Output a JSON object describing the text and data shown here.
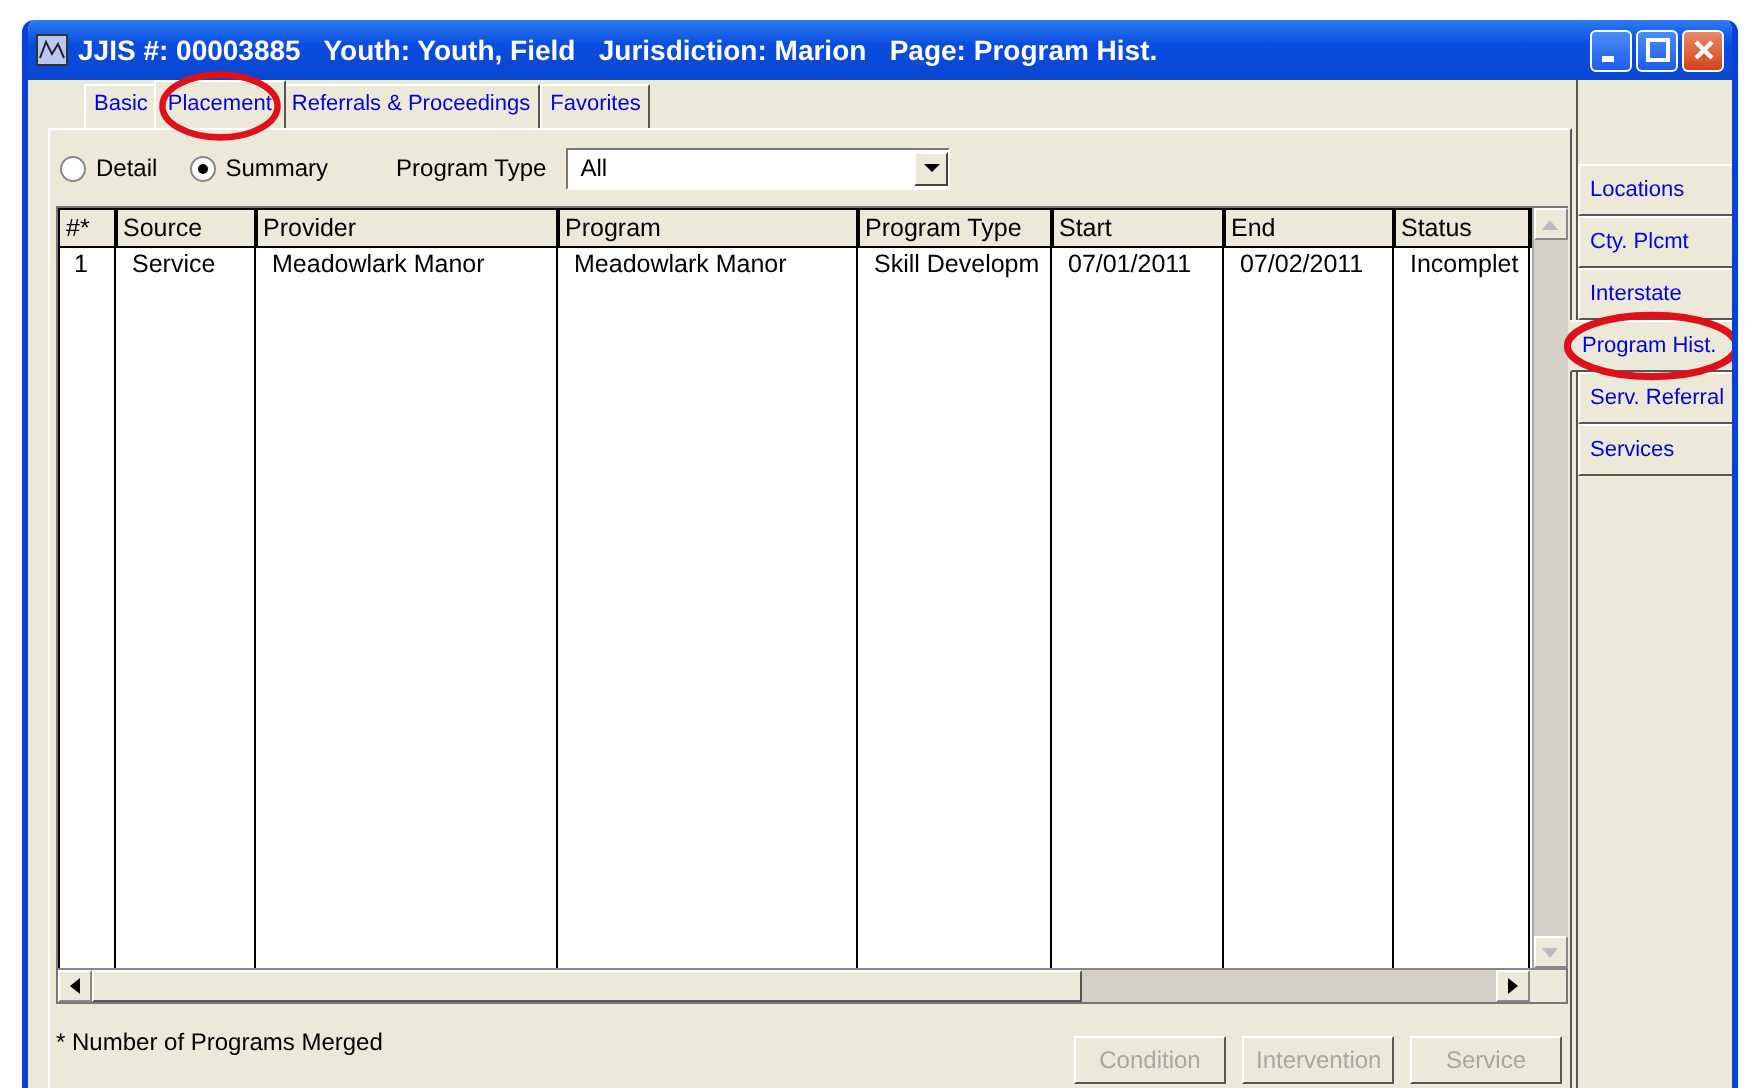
{
  "window": {
    "title": "JJIS #: 00003885   Youth: Youth, Field   Jurisdiction: Marion   Page: Program Hist."
  },
  "tabs": [
    {
      "label": "Basic",
      "selected": false,
      "circled": false
    },
    {
      "label": "Placement",
      "selected": true,
      "circled": true
    },
    {
      "label": "Referrals & Proceedings",
      "selected": false,
      "circled": false
    },
    {
      "label": "Favorites",
      "selected": false,
      "circled": false
    }
  ],
  "view": [
    {
      "label": "Detail",
      "selected": false
    },
    {
      "label": "Summary",
      "selected": true
    }
  ],
  "program_type": {
    "label": "Program Type",
    "value": "All"
  },
  "table": {
    "columns": [
      "#*",
      "Source",
      "Provider",
      "Program",
      "Program Type",
      "Start",
      "End",
      "Status"
    ],
    "rows": [
      [
        "1",
        "Service",
        "Meadowlark Manor",
        "Meadowlark Manor",
        "Skill Developm",
        "07/01/2011",
        "07/02/2011",
        "Incomplet"
      ]
    ]
  },
  "footnote": "* Number of Programs Merged",
  "buttons": [
    {
      "label": "Condition",
      "disabled": true
    },
    {
      "label": "Intervention",
      "disabled": true
    },
    {
      "label": "Service",
      "disabled": true
    }
  ],
  "side_tabs": [
    {
      "label": "Locations",
      "selected": false,
      "circled": false
    },
    {
      "label": "Cty. Plcmt",
      "selected": false,
      "circled": false
    },
    {
      "label": "Interstate",
      "selected": false,
      "circled": false
    },
    {
      "label": "Program Hist.",
      "selected": true,
      "circled": true
    },
    {
      "label": "Serv. Referral",
      "selected": false,
      "circled": false
    },
    {
      "label": "Services",
      "selected": false,
      "circled": false
    }
  ]
}
